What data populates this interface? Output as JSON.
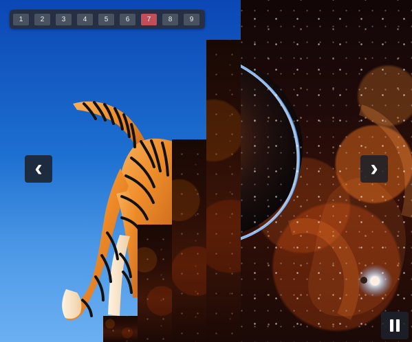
{
  "pagination": {
    "pages": [
      "1",
      "2",
      "3",
      "4",
      "5",
      "6",
      "7",
      "8",
      "9"
    ],
    "current": "7"
  },
  "navigation": {
    "previous_icon": "chevron-left-icon",
    "next_icon": "chevron-right-icon"
  },
  "controls": {
    "pause_icon": "pause-icon"
  },
  "colors": {
    "pager_bg": "#282d3a",
    "button_bg": "#485261",
    "active_page": "#c34e59",
    "nav_bg": "#1c212a"
  }
}
